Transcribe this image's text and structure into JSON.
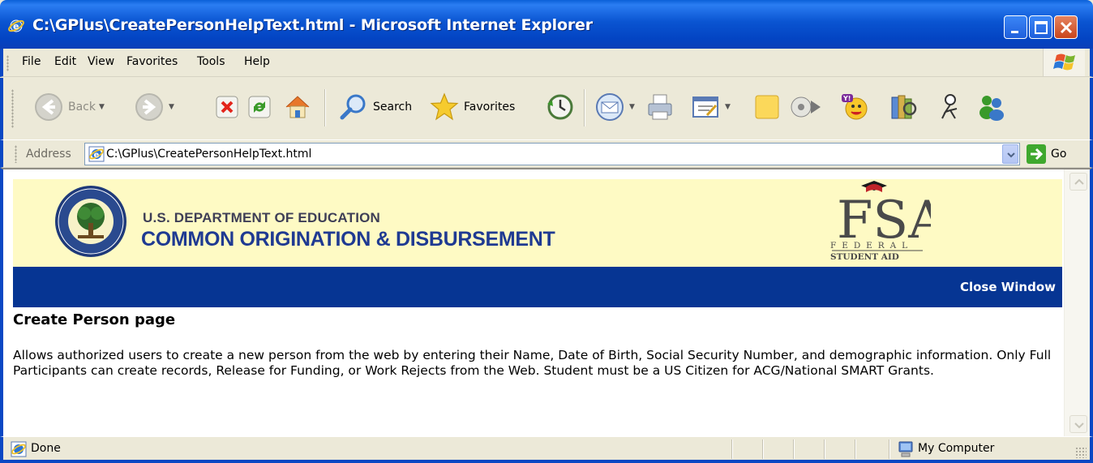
{
  "window": {
    "title": "C:\\GPlus\\CreatePersonHelpText.html - Microsoft Internet Explorer"
  },
  "menu": {
    "items": [
      "File",
      "Edit",
      "View",
      "Favorites",
      "Tools",
      "Help"
    ]
  },
  "toolbar": {
    "back_label": "Back",
    "search_label": "Search",
    "favorites_label": "Favorites"
  },
  "address": {
    "label": "Address",
    "value": "C:\\GPlus\\CreatePersonHelpText.html",
    "go_label": "Go"
  },
  "banner": {
    "dept": "U.S. DEPARTMENT OF EDUCATION",
    "cod": "COMMON ORIGINATION & DISBURSEMENT",
    "fsa_letters": "FSA",
    "fsa_federal": "F E D E R A L",
    "fsa_student_aid": "STUDENT AID"
  },
  "nav": {
    "close_window": "Close Window"
  },
  "content": {
    "heading": "Create Person page",
    "description": "Allows authorized users to create a new person from the web by entering their Name, Date of Birth, Social Security Number, and demographic information. Only Full Participants can create records, Release for Funding, or Work Rejects from the Web. Student must be a US Citizen for ACG/National SMART Grants."
  },
  "status": {
    "text": "Done",
    "zone": "My Computer"
  },
  "colors": {
    "titlebar": "#0a54d1",
    "banner_bg": "#fefac4",
    "bluebar": "#063593",
    "cod_text": "#1f3a92"
  }
}
